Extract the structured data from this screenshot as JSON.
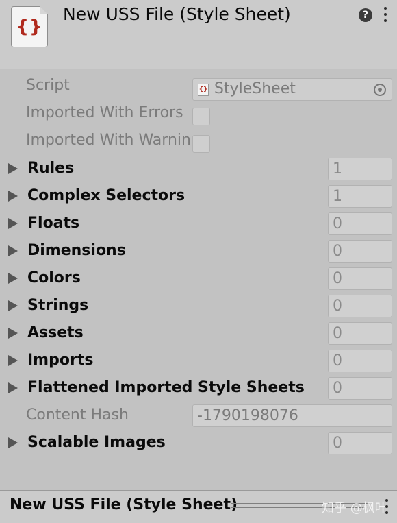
{
  "header": {
    "title": "New USS File (Style Sheet)",
    "file_icon": "uss-braces-icon",
    "file_icon_glyph": "{}",
    "help_glyph": "?"
  },
  "fields": {
    "script": {
      "label": "Script",
      "value": "StyleSheet",
      "icon_glyph": "{}"
    },
    "imported_with_errors": {
      "label": "Imported With Errors",
      "checked": false
    },
    "imported_with_warnings": {
      "label": "Imported With Warnin",
      "checked": false
    },
    "content_hash": {
      "label": "Content Hash",
      "value": "-1790198076"
    }
  },
  "arrays": [
    {
      "label": "Rules",
      "count": "1"
    },
    {
      "label": "Complex Selectors",
      "count": "1"
    },
    {
      "label": "Floats",
      "count": "0"
    },
    {
      "label": "Dimensions",
      "count": "0"
    },
    {
      "label": "Colors",
      "count": "0"
    },
    {
      "label": "Strings",
      "count": "0"
    },
    {
      "label": "Assets",
      "count": "0"
    },
    {
      "label": "Imports",
      "count": "0"
    },
    {
      "label": "Flattened Imported Style Sheets",
      "count": "0"
    }
  ],
  "scalable_images": {
    "label": "Scalable Images",
    "count": "0"
  },
  "footer": {
    "title": "New USS File (Style Sheet)",
    "watermark": "知乎 @枫叶"
  },
  "colors": {
    "icon_red": "#b02a1e",
    "panel_bg": "#c2c2c2",
    "header_bg": "#cbcbcb"
  }
}
